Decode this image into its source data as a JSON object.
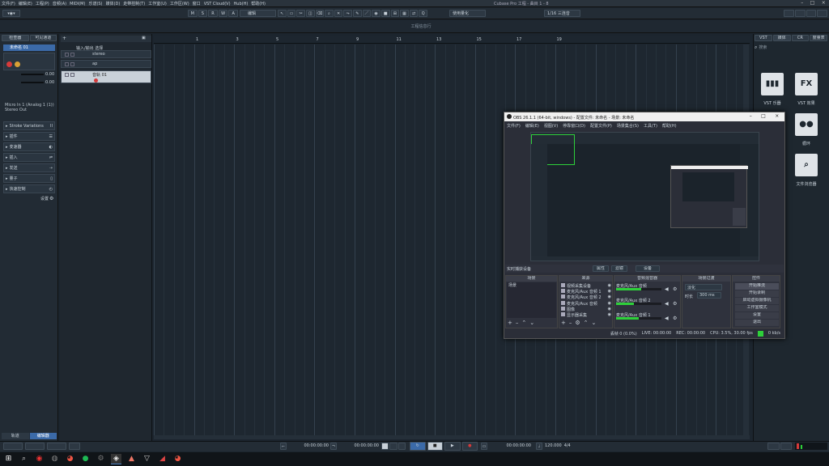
{
  "window": {
    "title": "Cubase Pro 工程 - 曲目 1 - 8",
    "menu": [
      "文件(F)",
      "编辑(E)",
      "工程(P)",
      "音频(A)",
      "MIDI(M)",
      "乐谱(S)",
      "媒体(D)",
      "走带控制(T)",
      "工作室(U)",
      "工作区(W)",
      "窗口",
      "VST Cloud(V)",
      "Hub(H)",
      "帮助(H)"
    ]
  },
  "toolbar": {
    "left_btn": "▾◉▾",
    "msrwa": [
      "M",
      "S",
      "R",
      "W",
      "A"
    ],
    "mode_label": "编辑",
    "snap_label": "1/16",
    "grid_select": "使用量化",
    "quantize_select": "1/16 三连音"
  },
  "info_line": "工程信息行",
  "left_zone": {
    "tabs": [
      "检查器",
      "可见通道"
    ],
    "track_name": "未命名 01",
    "readouts": [
      "0.00",
      "0.00"
    ],
    "midi_input": "Micro In 1 (Analog 1 (1))",
    "midi_out": "Stereo Out",
    "sections": [
      "Stroke Variations",
      "插件",
      "变速器",
      "插入",
      "发送",
      "量子",
      "快速控制"
    ],
    "section_icons": [
      "II",
      "☰",
      "◐",
      "⇌",
      "⇢",
      "▯",
      "◴"
    ],
    "setup_label": "设置"
  },
  "tracks": {
    "header_label": "输入/输出 选择",
    "rows": [
      {
        "name": "stereo"
      },
      {
        "name": "ap"
      },
      {
        "name": "音轨 01"
      }
    ]
  },
  "ruler": {
    "marks": [
      "1",
      "3",
      "5",
      "7",
      "9",
      "11",
      "13",
      "15",
      "17",
      "19"
    ]
  },
  "right_zone": {
    "tabs": [
      "VST",
      "媒体",
      "CR",
      "度量表"
    ],
    "search_placeholder": "搜索",
    "items": [
      {
        "label": "VST 乐器",
        "icon": "piano-icon"
      },
      {
        "label": "VST 效果",
        "icon": "fx-icon"
      },
      {
        "label": "循环",
        "icon": "loop-icon"
      },
      {
        "label": "文件浏览器",
        "icon": "file-browser-icon"
      }
    ]
  },
  "obs": {
    "title": "OBS 26.1.1 (64-bit, windows) - 配置文件: 未命名 - 场景: 未命名",
    "menu": [
      "文件(F)",
      "编辑(E)",
      "视图(V)",
      "停靠窗口(D)",
      "配置文件(P)",
      "场景集合(S)",
      "工具(T)",
      "帮助(H)"
    ],
    "toolbar_text": "实时捕获设备",
    "btn_props": "属性",
    "btn_filter": "滤镜",
    "btn_settings": "设备",
    "panels": [
      "场景",
      "来源",
      "音频混音器",
      "场景过渡",
      "控件"
    ],
    "scenes": [
      "场景"
    ],
    "sources": [
      "视频采集设备",
      "麦克风/Aux 音频 1",
      "麦克风/Aux 音频 2",
      "麦克风/Aux 音频",
      "图像",
      "显示器采集"
    ],
    "mixer": [
      {
        "name": "麦克风/Aux 音频",
        "level": 0.55
      },
      {
        "name": "麦克风/Aux 音频 2",
        "level": 0.4
      },
      {
        "name": "麦克风/Aux 音频 1",
        "level": 0.5
      }
    ],
    "transition": {
      "type": "淡化",
      "duration_label": "时长",
      "duration": "300 ms"
    },
    "controls": [
      "开始推流",
      "开始录制",
      "启动虚拟摄像机",
      "工作室模式",
      "设置",
      "退出"
    ],
    "status": {
      "drop": "丢帧 0 (0.0%)",
      "live": "LIVE: 00:00:00",
      "rec": "REC: 00:00:00",
      "cpu": "CPU: 3.5%, 30.00 fps",
      "kbps": "0 kb/s"
    }
  },
  "transport": {
    "pos1": "00:00:00:00",
    "pos2": "00:00:00:00",
    "pos3": "00:00:00:00",
    "tempo": "120.000",
    "sig": "4/4"
  },
  "bottom_left_tabs": [
    "轨道",
    "编辑器"
  ],
  "taskbar": {
    "icons": [
      "windows-icon",
      "search-icon",
      "app-red-icon",
      "media-player-icon",
      "chrome-icon",
      "spotify-icon",
      "settings-icon",
      "cubase-icon",
      "vlc-icon",
      "app-triangle-icon",
      "app-red2-icon",
      "chrome2-icon"
    ]
  },
  "colors": {
    "obs_green": "#2ed03a",
    "record": "#d63a3a",
    "accent": "#4a7fc0"
  }
}
